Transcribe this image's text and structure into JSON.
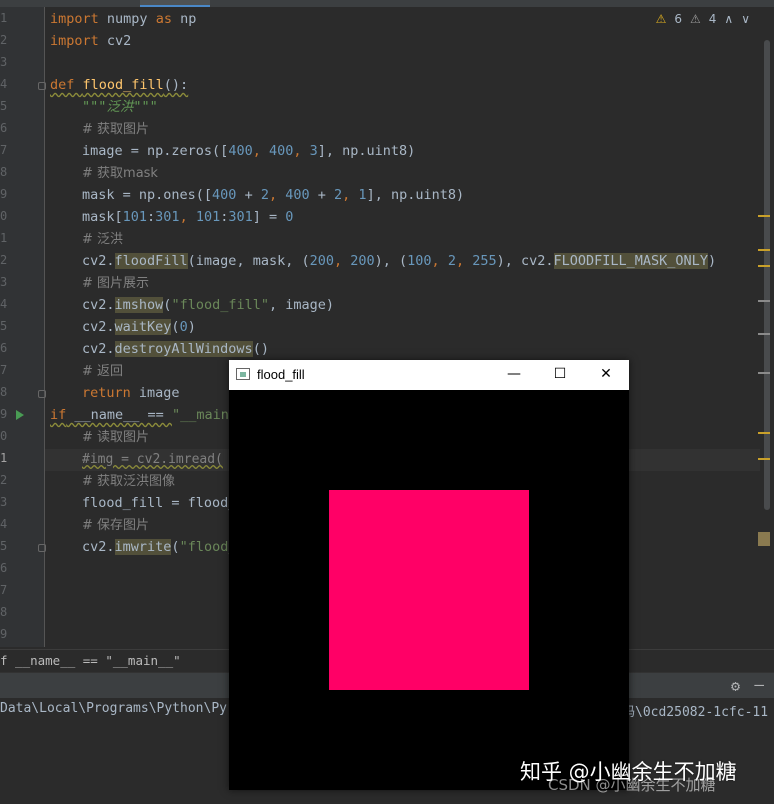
{
  "editor": {
    "line_numbers": [
      "1",
      "2",
      "3",
      "4",
      "5",
      "6",
      "7",
      "8",
      "9",
      "0",
      "1",
      "2",
      "3",
      "4",
      "5",
      "6",
      "7",
      "8",
      "9",
      "0",
      "1",
      "2",
      "3",
      "4",
      "5",
      "6",
      "7",
      "8",
      "9"
    ],
    "inspection": {
      "errors_count": "6",
      "warnings_count": "4",
      "up": "∧",
      "down": "∨"
    },
    "code": {
      "l1_a": "import",
      "l1_b": " numpy ",
      "l1_c": "as",
      "l1_d": " np",
      "l2_a": "import",
      "l2_b": " cv2",
      "l4_a": "def ",
      "l4_b": "flood_fill",
      "l4_c": "():",
      "l5": "\"\"\"泛洪\"\"\"",
      "l6": "# 获取图片",
      "l7_a": "image = np.zeros([",
      "l7_b": "400",
      "l7_c": ", ",
      "l7_d": "400",
      "l7_e": ", ",
      "l7_f": "3",
      "l7_g": "], np.uint8)",
      "l8": "# 获取mask",
      "l9_a": "mask = np.ones([",
      "l9_b": "400",
      "l9_c": " + ",
      "l9_d": "2",
      "l9_e": ", ",
      "l9_f": "400",
      "l9_g": " + ",
      "l9_h": "2",
      "l9_i": ", ",
      "l9_j": "1",
      "l9_k": "], np.uint8)",
      "l10_a": "mask[",
      "l10_b": "101",
      "l10_c": ":",
      "l10_d": "301",
      "l10_e": ", ",
      "l10_f": "101",
      "l10_g": ":",
      "l10_h": "301",
      "l10_i": "] = ",
      "l10_j": "0",
      "l11": "# 泛洪",
      "l12_a": "cv2.",
      "l12_b": "floodFill",
      "l12_c": "(image, mask, (",
      "l12_d": "200",
      "l12_e": ", ",
      "l12_f": "200",
      "l12_g": "), (",
      "l12_h": "100",
      "l12_i": ", ",
      "l12_j": "2",
      "l12_k": ", ",
      "l12_l": "255",
      "l12_m": "), cv2.",
      "l12_n": "FLOODFILL_MASK_ONLY",
      "l12_o": ")",
      "l13": "# 图片展示",
      "l14_a": "cv2.",
      "l14_b": "imshow",
      "l14_c": "(",
      "l14_d": "\"flood_fill\"",
      "l14_e": ", image)",
      "l15_a": "cv2.",
      "l15_b": "waitKey",
      "l15_c": "(",
      "l15_d": "0",
      "l15_e": ")",
      "l16_a": "cv2.",
      "l16_b": "destroyAllWindows",
      "l16_c": "()",
      "l17": "# 返回",
      "l18_a": "return",
      "l18_b": " image",
      "l19_a": "if",
      "l19_b": " __name__ == ",
      "l19_c": "\"__main",
      "l20": "# 读取图片",
      "l21": "#img = cv2.imread(",
      "l22": "# 获取泛洪图像",
      "l23": "flood_fill = flood_",
      "l24": "# 保存图片",
      "l25_a": "cv2.",
      "l25_b": "imwrite",
      "l25_c": "(",
      "l25_d": "\"flood_"
    }
  },
  "breadcrumb": "f __name__ == \"__main__\"",
  "run_panel": {
    "path_left": "Data\\Local\\Programs\\Python\\Py",
    "path_right": "码\\0cd25082-1cfc-11"
  },
  "cv_window": {
    "title": "flood_fill",
    "minimize": "—",
    "maximize": "☐",
    "close": "✕"
  },
  "watermark": {
    "primary": "知乎 @小幽余生不加糖",
    "secondary": "CSDN @小幽余生不加糖"
  },
  "colors": {
    "fill": "#ff0066",
    "editor_bg": "#2b2b2b"
  }
}
